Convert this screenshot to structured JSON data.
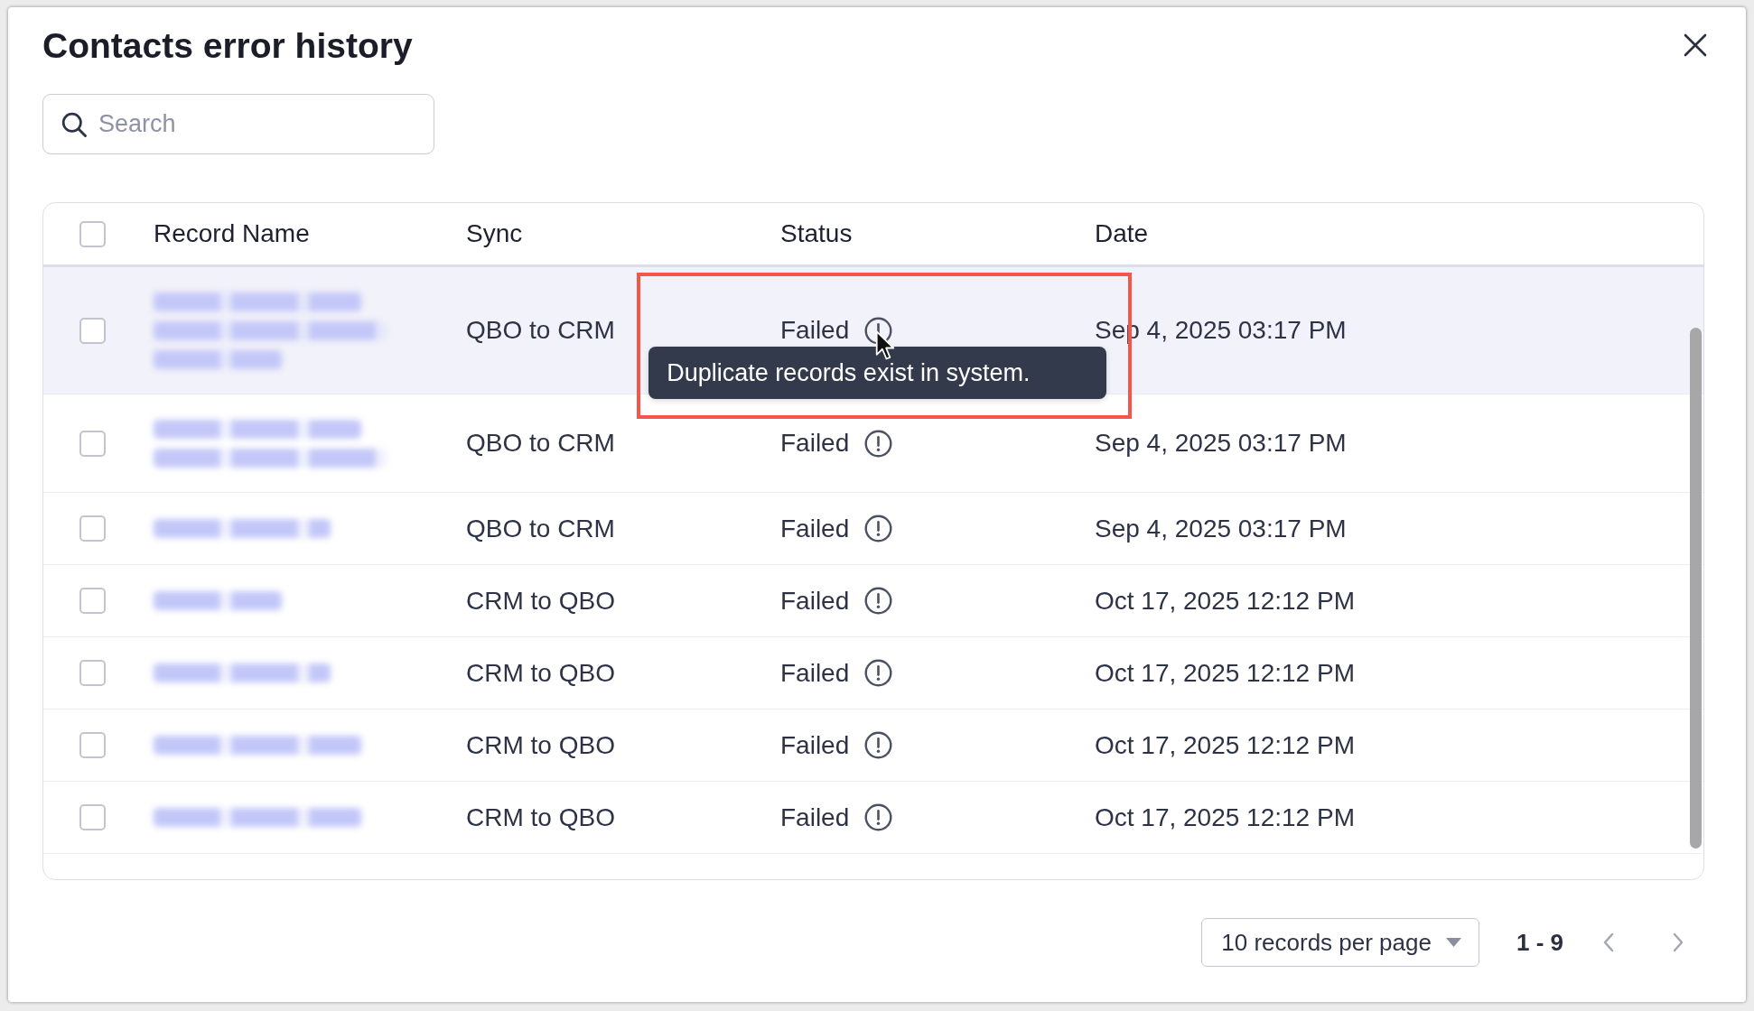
{
  "dialog": {
    "title": "Contacts error history"
  },
  "search": {
    "placeholder": "Search"
  },
  "table": {
    "select_all": {
      "checked": false
    },
    "columns": [
      "Record Name",
      "Sync",
      "Status",
      "Date"
    ],
    "rows": [
      {
        "checked": false,
        "hovered": true,
        "record_name": {
          "redacted_lines": [
            {
              "kind": "long"
            },
            {
              "kind": "xlong"
            },
            {
              "kind": "short"
            }
          ]
        },
        "sync": "QBO to CRM",
        "status": {
          "text": "Failed",
          "tooltip": {
            "text": "Duplicate records exist in system.",
            "highlighted": true
          }
        },
        "date": "Sep 4, 2025 03:17 PM"
      },
      {
        "checked": false,
        "hovered": false,
        "record_name": {
          "redacted_lines": [
            {
              "kind": "long"
            },
            {
              "kind": "xlong"
            }
          ]
        },
        "sync": "QBO to CRM",
        "status": {
          "text": "Failed"
        },
        "date": "Sep 4, 2025 03:17 PM"
      },
      {
        "checked": false,
        "hovered": false,
        "record_name": {
          "redacted_lines": [
            {
              "kind": "medium"
            }
          ]
        },
        "sync": "QBO to CRM",
        "status": {
          "text": "Failed"
        },
        "date": "Sep 4, 2025 03:17 PM"
      },
      {
        "checked": false,
        "hovered": false,
        "record_name": {
          "redacted_lines": [
            {
              "kind": "short"
            }
          ]
        },
        "sync": "CRM to QBO",
        "status": {
          "text": "Failed"
        },
        "date": "Oct 17, 2025 12:12 PM"
      },
      {
        "checked": false,
        "hovered": false,
        "record_name": {
          "redacted_lines": [
            {
              "kind": "medium"
            }
          ]
        },
        "sync": "CRM to QBO",
        "status": {
          "text": "Failed"
        },
        "date": "Oct 17, 2025 12:12 PM"
      },
      {
        "checked": false,
        "hovered": false,
        "record_name": {
          "redacted_lines": [
            {
              "kind": "long"
            }
          ]
        },
        "sync": "CRM to QBO",
        "status": {
          "text": "Failed"
        },
        "date": "Oct 17, 2025 12:12 PM"
      },
      {
        "checked": false,
        "hovered": false,
        "record_name": {
          "redacted_lines": [
            {
              "kind": "long"
            }
          ]
        },
        "sync": "CRM to QBO",
        "status": {
          "text": "Failed"
        },
        "date": "Oct 17, 2025 12:12 PM"
      }
    ]
  },
  "pagination": {
    "page_size": "10 records per page",
    "range": "1 - 9",
    "previous": {
      "disabled": true
    },
    "next": {
      "disabled": true
    }
  }
}
